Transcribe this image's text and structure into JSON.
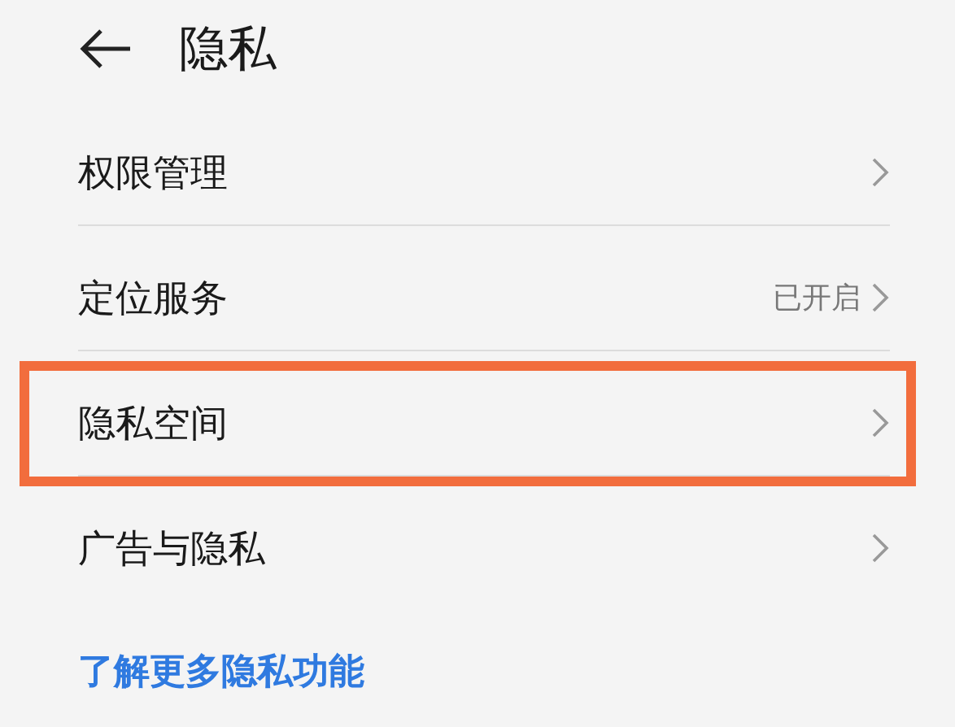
{
  "header": {
    "title": "隐私"
  },
  "rows": [
    {
      "label": "权限管理",
      "highlighted": false
    },
    {
      "label": "定位服务",
      "value": "已开启",
      "highlighted": false
    },
    {
      "label": "隐私空间",
      "highlighted": true
    },
    {
      "label": "广告与隐私",
      "highlighted": false
    }
  ],
  "link": "了解更多隐私功能"
}
